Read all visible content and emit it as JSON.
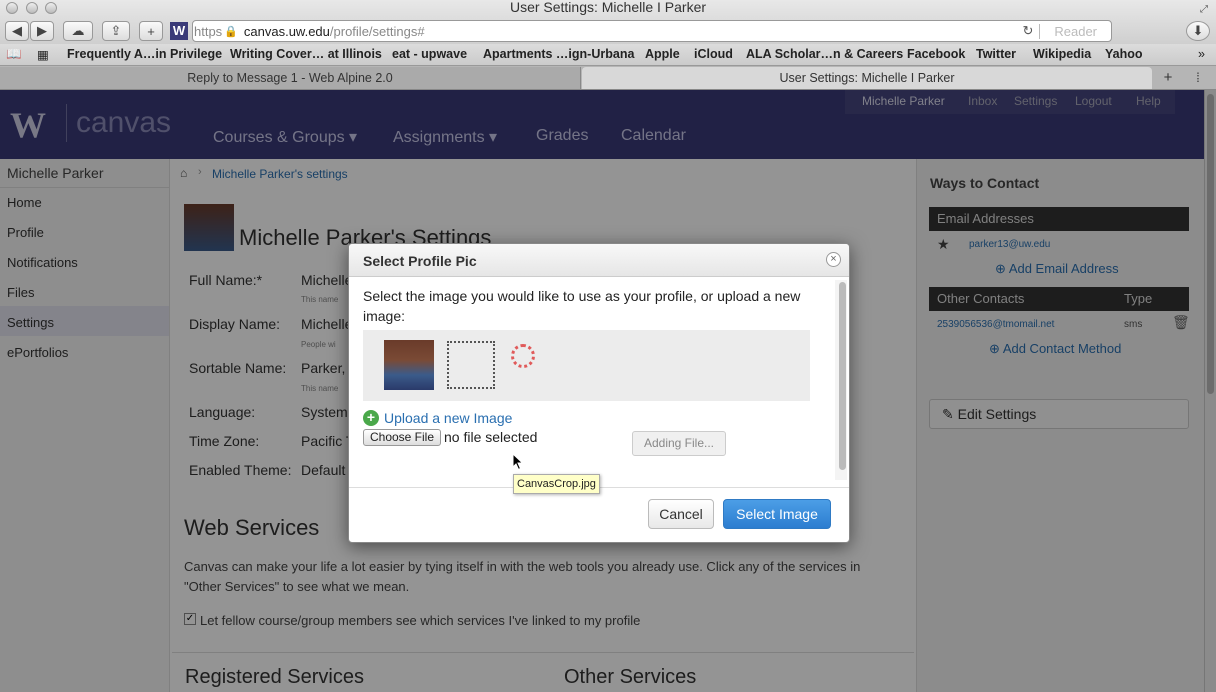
{
  "window": {
    "title": "User Settings: Michelle I Parker"
  },
  "toolbar": {
    "back": "◀",
    "forward": "▶",
    "add": "+",
    "reader": "Reader"
  },
  "url": {
    "scheme": "https",
    "host": "canvas.uw.edu",
    "path": "/profile/settings#"
  },
  "bookmarks": [
    "Frequently A…in Privilege",
    "Writing Cover… at Illinois",
    "eat - upwave",
    "Apartments …ign-Urbana",
    "Apple",
    "iCloud",
    "ALA Scholar…n & Careers",
    "Facebook",
    "Twitter",
    "Wikipedia",
    "Yahoo"
  ],
  "tabs": [
    "Reply to Message 1 - Web Alpine 2.0",
    "User Settings: Michelle I Parker"
  ],
  "canvas": {
    "logo_w": "W",
    "logo_text": "canvas",
    "nav": [
      "Courses & Groups",
      "Assignments",
      "Grades",
      "Calendar"
    ],
    "toplinks": [
      "Michelle Parker",
      "Inbox",
      "Settings",
      "Logout",
      "Help"
    ]
  },
  "leftnav": {
    "user": "Michelle Parker",
    "items": [
      "Home",
      "Profile",
      "Notifications",
      "Files",
      "Settings",
      "ePortfolios"
    ]
  },
  "breadcrumb": "Michelle Parker's settings",
  "settings": {
    "title": "Michelle Parker's Settings",
    "labels": [
      "Full Name:*",
      "Display Name:",
      "Sortable Name:",
      "Language:",
      "Time Zone:",
      "Enabled Theme:"
    ],
    "values": [
      "Michelle",
      "Michelle",
      "Parker, M",
      "System",
      "Pacific T",
      "Default"
    ],
    "notes": [
      "This name",
      "People wi",
      "This name"
    ]
  },
  "web_services": {
    "heading": "Web Services",
    "text1": "Canvas can make your life a lot easier by tying itself in with the web tools you already use. Click any of the services in",
    "text2": "\"Other Services\" to see what we mean.",
    "checkbox_label": "Let fellow course/group members see which services I've linked to my profile",
    "registered": "Registered Services",
    "other": "Other Services"
  },
  "right": {
    "heading": "Ways to Contact",
    "email_header": "Email Addresses",
    "email": "parker13@uw.edu",
    "add_email": "Add Email Address",
    "other_header": "Other Contacts",
    "type_header": "Type",
    "contact": "2539056536@tmomail.net",
    "contact_type": "sms",
    "add_contact": "Add Contact Method",
    "edit_settings": "Edit Settings"
  },
  "dialog": {
    "title": "Select Profile Pic",
    "instructions": "Select the image you would like to use as your profile, or upload a new image:",
    "upload_link": "Upload a new Image",
    "choose_file": "Choose File",
    "no_file": "no file selected",
    "adding": "Adding File...",
    "cancel": "Cancel",
    "select": "Select Image",
    "tooltip": "CanvasCrop.jpg"
  }
}
